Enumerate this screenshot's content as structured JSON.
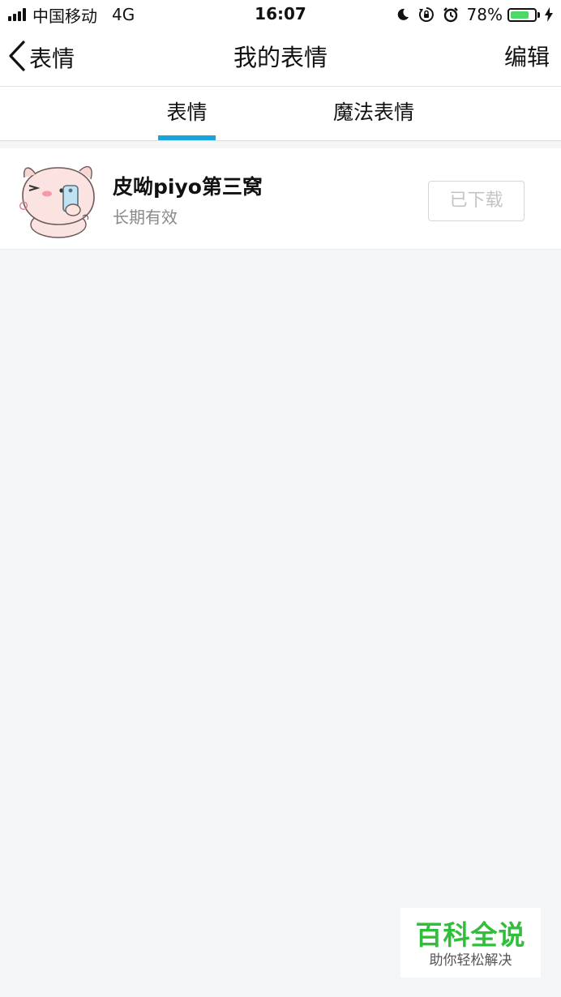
{
  "status_bar": {
    "carrier": "中国移动",
    "network": "4G",
    "time": "16:07",
    "battery": "78%",
    "battery_level": 0.78,
    "icons": [
      "moon-icon",
      "rotation-lock-icon",
      "alarm-icon",
      "battery-icon",
      "charging-icon"
    ]
  },
  "nav": {
    "back_label": "表情",
    "title": "我的表情",
    "edit_label": "编辑"
  },
  "tabs": [
    {
      "label": "表情",
      "active": true
    },
    {
      "label": "魔法表情",
      "active": false
    }
  ],
  "sticker_packs": [
    {
      "title": "皮呦piyo第三窝",
      "subtitle": "长期有效",
      "button_label": "已下载"
    }
  ],
  "watermark": {
    "title": "百科全说",
    "subtitle": "助你轻松解决"
  },
  "colors": {
    "tab_accent": "#1aa4dc",
    "battery": "#4cd964",
    "watermark": "#2fbf3a",
    "background": "#f4f5f7"
  }
}
